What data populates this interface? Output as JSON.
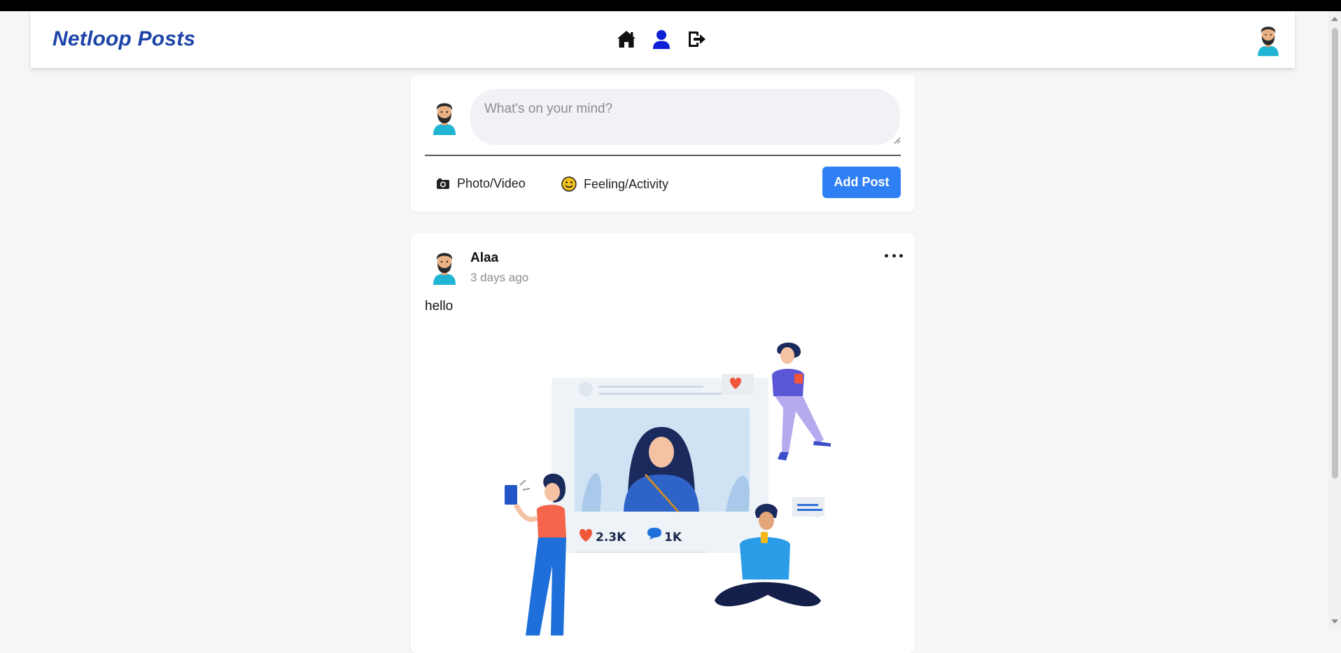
{
  "app": {
    "brand": "Netloop Posts"
  },
  "nav": {
    "icons": [
      "home-icon",
      "profile-icon",
      "logout-icon"
    ],
    "active": "profile-icon",
    "colors": {
      "brand": "#1d44a8",
      "active_icon": "#0d1fd6",
      "button": "#2f80f5"
    }
  },
  "composer": {
    "placeholder": "What's on your mind?",
    "photo_label": "Photo/Video",
    "feeling_label": "Feeling/Activity",
    "submit_label": "Add Post"
  },
  "post": {
    "author": "Alaa",
    "time": "3 days ago",
    "text": "hello",
    "image": {
      "likes": "2.3K",
      "comments": "1K"
    }
  }
}
